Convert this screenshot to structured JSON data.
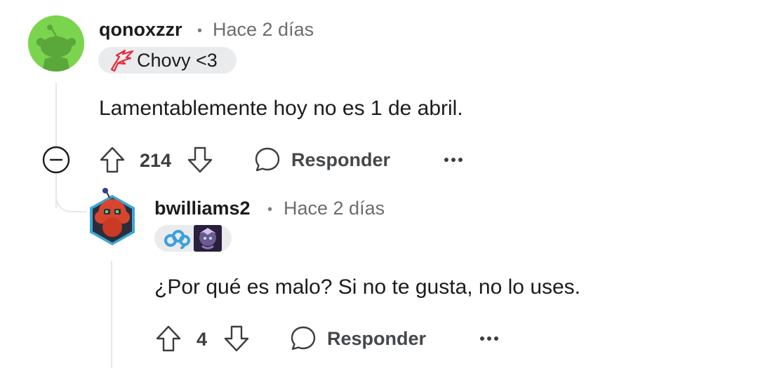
{
  "comments": [
    {
      "username": "qonoxzzr",
      "separator": "•",
      "timestamp": "Hace 2 días",
      "flair_text": "Chovy <3",
      "body": "Lamentablemente hoy no es 1 de abril.",
      "score": "214",
      "reply_label": "Responder",
      "avatar_color": "#7bd44e"
    },
    {
      "username": "bwilliams2",
      "separator": "•",
      "timestamp": "Hace 2 días",
      "flair_text": "",
      "body": "¿Por qué es malo? Si no te gusta, no lo uses.",
      "score": "4",
      "reply_label": "Responder"
    }
  ],
  "icons": {
    "collapse": "minus-circle-icon",
    "upvote": "arrow-up-icon",
    "downvote": "arrow-down-icon",
    "reply": "speech-bubble-icon",
    "more": "ellipsis-icon"
  },
  "colors": {
    "flair_bg": "#e9ebed",
    "thread_line": "#e5e7ea",
    "meta_text": "#6a6d70"
  }
}
